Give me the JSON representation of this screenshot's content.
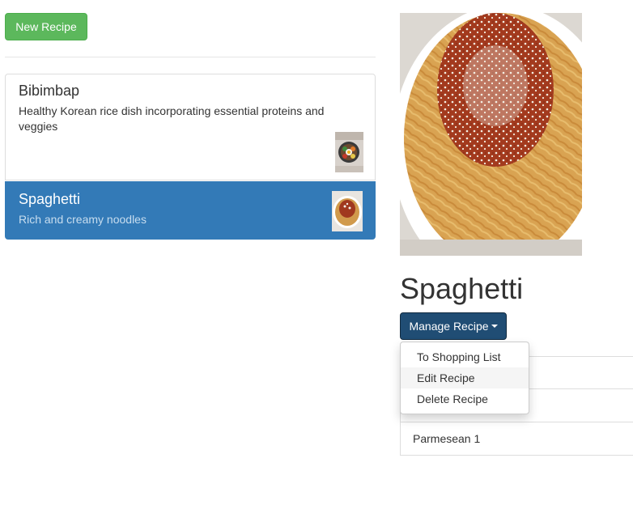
{
  "toolbar": {
    "new_recipe_label": "New Recipe"
  },
  "recipes": [
    {
      "name": "Bibimbap",
      "description": "Healthy Korean rice dish incorporating essential proteins and veggies",
      "selected": false
    },
    {
      "name": "Spaghetti",
      "description": "Rich and creamy noodles",
      "selected": true
    }
  ],
  "detail": {
    "title": "Spaghetti",
    "manage_label": "Manage Recipe",
    "menu": [
      "To Shopping List",
      "Edit Recipe",
      "Delete Recipe"
    ],
    "ingredients": [
      "",
      "",
      "Parmesean 1"
    ]
  },
  "colors": {
    "success": "#5cb85c",
    "primary": "#337ab7",
    "primary_dark": "#204d74"
  }
}
